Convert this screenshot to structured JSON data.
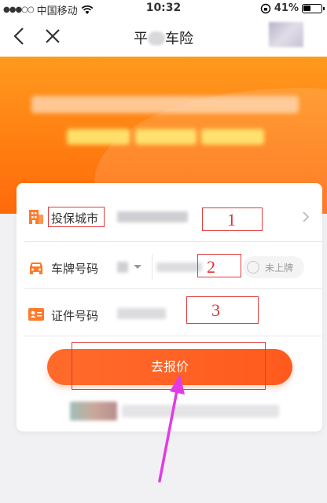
{
  "status_bar": {
    "carrier": "中国移动",
    "time": "10:32",
    "battery": "41%"
  },
  "nav": {
    "title_prefix": "平",
    "title_suffix": "车险"
  },
  "form": {
    "city_label": "投保城市",
    "plate_label": "车牌号码",
    "unregistered_label": "未上牌",
    "id_label": "证件号码",
    "submit_label": "去报价"
  },
  "annotations": [
    "1",
    "2",
    "3"
  ],
  "colors": {
    "accent": "#ff6424",
    "banner": "#ff8a14",
    "annotation": "#e03c3c",
    "arrow": "#e23be6"
  }
}
